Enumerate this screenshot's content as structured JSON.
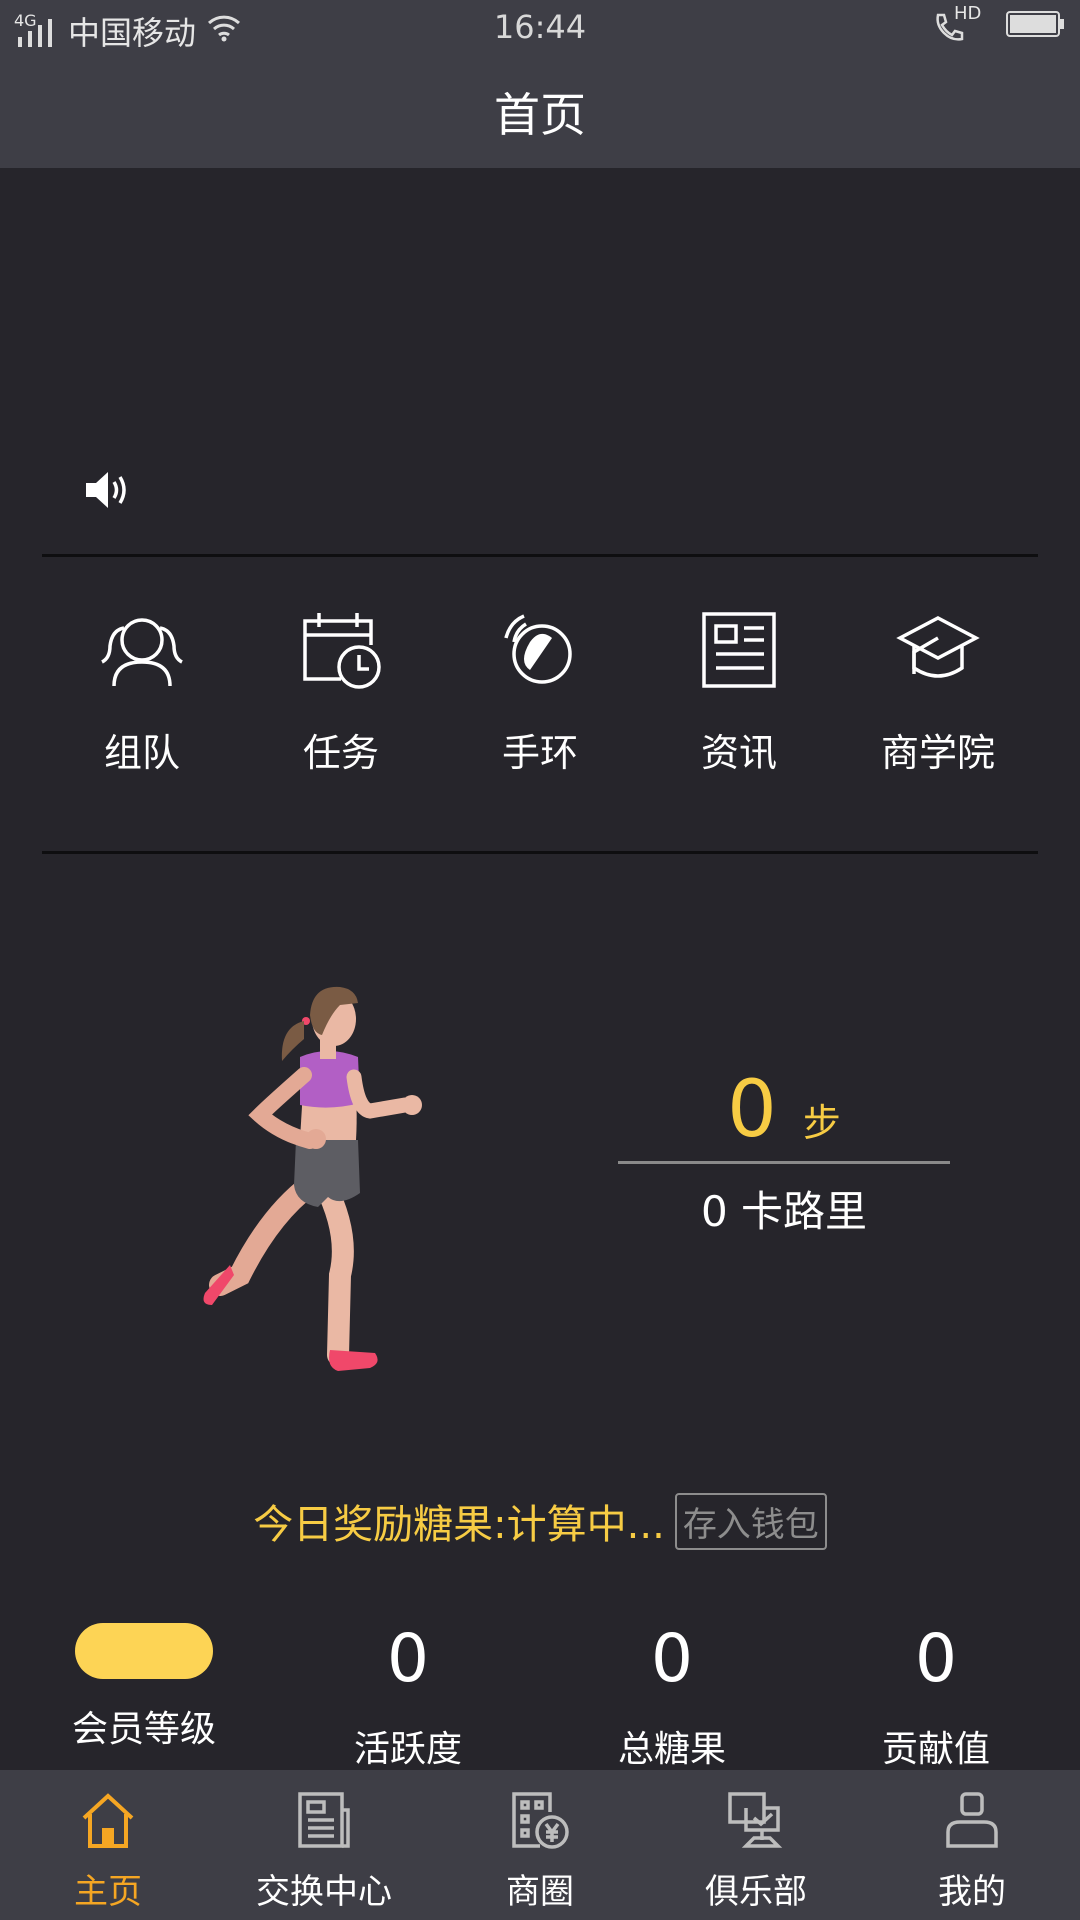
{
  "status_bar": {
    "network": "4G",
    "carrier": "中国移动",
    "time": "16:44",
    "hd": "HD"
  },
  "header": {
    "title": "首页"
  },
  "quick_actions": [
    {
      "label": "组队",
      "icon": "team-icon"
    },
    {
      "label": "任务",
      "icon": "task-calendar-icon"
    },
    {
      "label": "手环",
      "icon": "wristband-icon"
    },
    {
      "label": "资讯",
      "icon": "news-icon"
    },
    {
      "label": "商学院",
      "icon": "graduation-cap-icon"
    }
  ],
  "activity": {
    "steps": "0",
    "steps_unit": "步",
    "calories": "0 卡路里"
  },
  "reward": {
    "text": "今日奖励糖果:计算中...",
    "save_button": "存入钱包"
  },
  "stats": [
    {
      "value": "",
      "label": "会员等级"
    },
    {
      "value": "0",
      "label": "活跃度"
    },
    {
      "value": "0",
      "label": "总糖果"
    },
    {
      "value": "0",
      "label": "贡献值"
    }
  ],
  "tabs": [
    {
      "label": "主页",
      "icon": "home-icon",
      "active": true
    },
    {
      "label": "交换中心",
      "icon": "exchange-icon",
      "active": false
    },
    {
      "label": "商圈",
      "icon": "business-district-icon",
      "active": false
    },
    {
      "label": "俱乐部",
      "icon": "club-icon",
      "active": false
    },
    {
      "label": "我的",
      "icon": "profile-icon",
      "active": false
    }
  ],
  "colors": {
    "accent": "#f7cc44",
    "background": "#26252b",
    "bar": "#3e3e46",
    "tab_active": "#f5a623"
  }
}
